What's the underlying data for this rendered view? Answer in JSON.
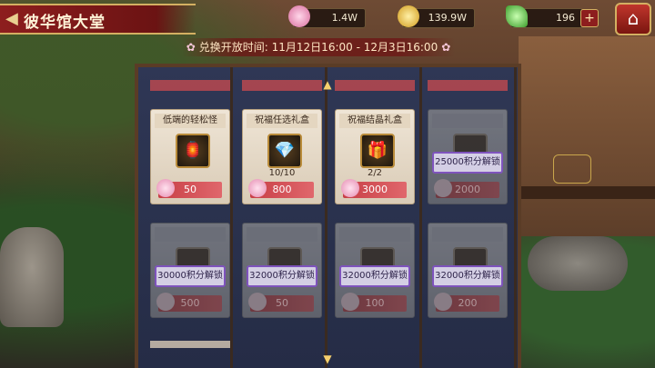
{
  "header": {
    "back_icon": "back-arrow-icon",
    "title": "彼华馆大堂"
  },
  "resources": {
    "petal": {
      "icon": "sakura-petal-icon",
      "value": "1.4W"
    },
    "gold": {
      "icon": "gold-coin-icon",
      "value": "139.9W"
    },
    "gem": {
      "icon": "jade-leaf-icon",
      "value": "196"
    },
    "plus_label": "+",
    "home_icon": "home-icon"
  },
  "event": {
    "time_text": "兑换开放时间: 11月12日16:00 - 12月3日16:00"
  },
  "cards": [
    {
      "name": "低端的轻松怪",
      "limit": "",
      "price": "50",
      "locked": false,
      "icon": "doll-icon",
      "glyph": "🏮"
    },
    {
      "name": "祝福任选礼盒",
      "limit": "10/10",
      "price": "800",
      "locked": false,
      "icon": "treasure-chest-icon",
      "glyph": "💎"
    },
    {
      "name": "祝福结晶礼盒",
      "limit": "2/2",
      "price": "3000",
      "locked": false,
      "icon": "gift-box-icon",
      "glyph": "🎁"
    },
    {
      "name": "",
      "limit": "",
      "price": "2000",
      "locked": true,
      "unlock_text": "25000积分解锁"
    },
    {
      "name": "",
      "limit": "",
      "price": "500",
      "locked": true,
      "unlock_text": "30000积分解锁"
    },
    {
      "name": "",
      "limit": "",
      "price": "50",
      "locked": true,
      "unlock_text": "32000积分解锁"
    },
    {
      "name": "",
      "limit": "",
      "price": "100",
      "locked": true,
      "unlock_text": "32000积分解锁"
    },
    {
      "name": "",
      "limit": "",
      "price": "200",
      "locked": true,
      "unlock_text": "32000积分解锁"
    }
  ],
  "colors": {
    "accent_red": "#8d1e1e",
    "gold_trim": "#d4b062",
    "unlock_border": "#8e5ad1"
  }
}
